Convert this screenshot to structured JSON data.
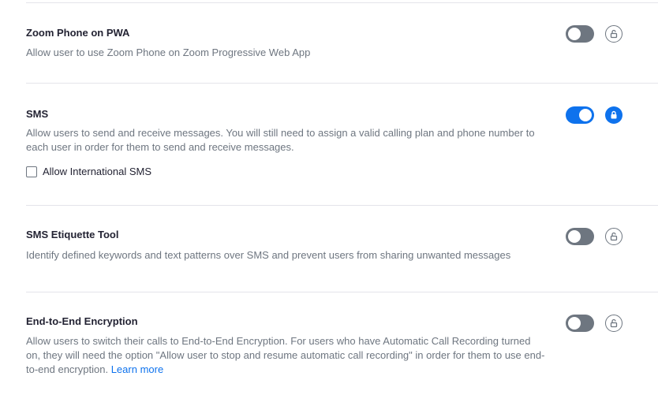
{
  "settings": [
    {
      "title": "Zoom Phone on PWA",
      "description": "Allow user to use Zoom Phone on Zoom Progressive Web App",
      "toggle": "off",
      "lock": "unlocked"
    },
    {
      "title": "SMS",
      "description": "Allow users to send and receive messages. You will still need to assign a valid calling plan and phone number to each user in order for them to send and receive messages.",
      "checkbox_label": "Allow International SMS",
      "checkbox_checked": false,
      "toggle": "on",
      "lock": "locked"
    },
    {
      "title": "SMS Etiquette Tool",
      "description": "Identify defined keywords and text patterns over SMS and prevent users from sharing unwanted messages",
      "toggle": "off",
      "lock": "unlocked"
    },
    {
      "title": "End-to-End Encryption",
      "description": "Allow users to switch their calls to End-to-End Encryption. For users who have Automatic Call Recording turned on, they will need the option \"Allow user to stop and resume automatic call recording\" in order for them to use end-to-end encryption.",
      "link": "Learn more",
      "toggle": "off",
      "lock": "unlocked"
    }
  ],
  "colors": {
    "accent": "#0e72ed",
    "toggle_off": "#6e7680",
    "divider": "#e4e4ea"
  }
}
